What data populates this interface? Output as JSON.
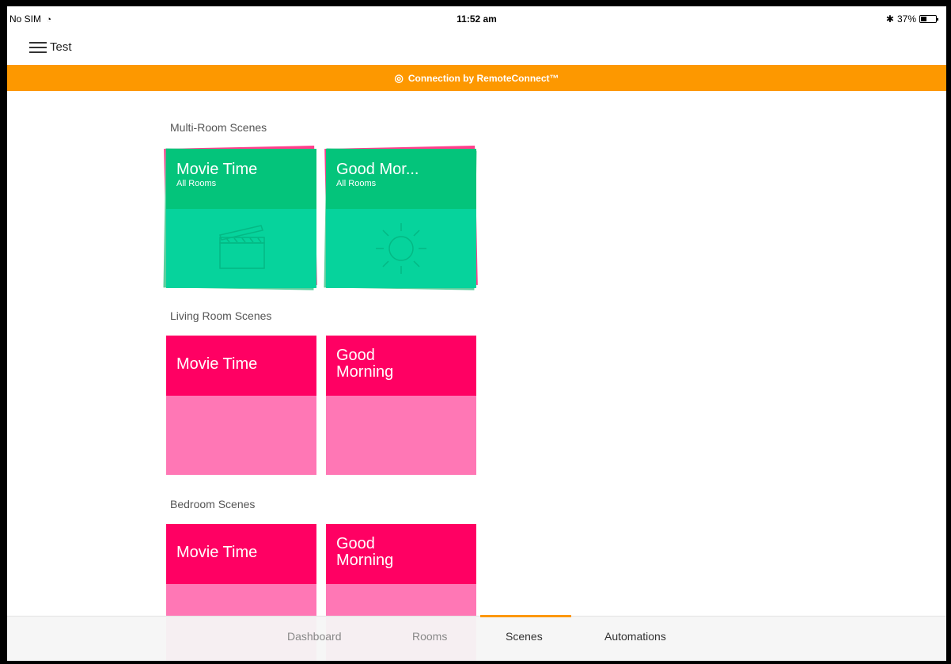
{
  "status_bar": {
    "carrier": "No SIM",
    "time": "11:52 am",
    "battery": "37%"
  },
  "header": {
    "title": "Test"
  },
  "banner": {
    "text": "Connection by RemoteConnect™"
  },
  "sections": [
    {
      "title": "Multi-Room Scenes",
      "tiles": [
        {
          "name": "Movie Time",
          "sub": "All Rooms",
          "icon": "clapperboard-icon"
        },
        {
          "name": "Good Mor...",
          "sub": "All Rooms",
          "icon": "sun-icon"
        }
      ]
    },
    {
      "title": "Living Room Scenes",
      "tiles": [
        {
          "name": "Movie Time"
        },
        {
          "name": "Good Morning"
        }
      ]
    },
    {
      "title": "Bedroom Scenes",
      "tiles": [
        {
          "name": "Movie Time"
        },
        {
          "name": "Good Morning"
        }
      ]
    }
  ],
  "tab_bar": {
    "tabs": [
      {
        "label": "Dashboard"
      },
      {
        "label": "Rooms"
      },
      {
        "label": "Scenes",
        "active": true
      },
      {
        "label": "Automations"
      }
    ]
  },
  "colors": {
    "accent_orange": "#fd9800",
    "scene_green_top": "#04c47b",
    "scene_green_bottom": "#06d39c",
    "scene_pink_top": "#ff0063",
    "scene_pink_bottom": "#ff77b5"
  }
}
